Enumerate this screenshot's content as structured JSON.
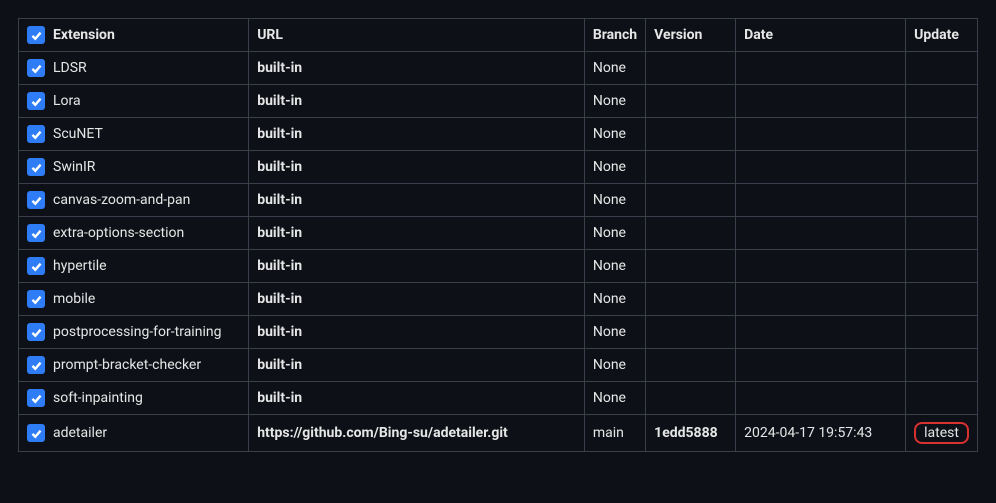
{
  "headers": {
    "extension": "Extension",
    "url": "URL",
    "branch": "Branch",
    "version": "Version",
    "date": "Date",
    "update": "Update"
  },
  "rows": [
    {
      "name": "LDSR",
      "url": "built-in",
      "url_bold": true,
      "branch": "None",
      "version": "",
      "date": "",
      "update": ""
    },
    {
      "name": "Lora",
      "url": "built-in",
      "url_bold": true,
      "branch": "None",
      "version": "",
      "date": "",
      "update": ""
    },
    {
      "name": "ScuNET",
      "url": "built-in",
      "url_bold": true,
      "branch": "None",
      "version": "",
      "date": "",
      "update": ""
    },
    {
      "name": "SwinIR",
      "url": "built-in",
      "url_bold": true,
      "branch": "None",
      "version": "",
      "date": "",
      "update": ""
    },
    {
      "name": "canvas-zoom-and-pan",
      "url": "built-in",
      "url_bold": true,
      "branch": "None",
      "version": "",
      "date": "",
      "update": ""
    },
    {
      "name": "extra-options-section",
      "url": "built-in",
      "url_bold": true,
      "branch": "None",
      "version": "",
      "date": "",
      "update": ""
    },
    {
      "name": "hypertile",
      "url": "built-in",
      "url_bold": true,
      "branch": "None",
      "version": "",
      "date": "",
      "update": ""
    },
    {
      "name": "mobile",
      "url": "built-in",
      "url_bold": true,
      "branch": "None",
      "version": "",
      "date": "",
      "update": ""
    },
    {
      "name": "postprocessing-for-training",
      "url": "built-in",
      "url_bold": true,
      "branch": "None",
      "version": "",
      "date": "",
      "update": ""
    },
    {
      "name": "prompt-bracket-checker",
      "url": "built-in",
      "url_bold": true,
      "branch": "None",
      "version": "",
      "date": "",
      "update": ""
    },
    {
      "name": "soft-inpainting",
      "url": "built-in",
      "url_bold": true,
      "branch": "None",
      "version": "",
      "date": "",
      "update": ""
    },
    {
      "name": "adetailer",
      "url": "https://github.com/Bing-su/adetailer.git",
      "url_bold": true,
      "branch": "main",
      "version": "1edd5888",
      "date": "2024-04-17 19:57:43",
      "update": "latest",
      "highlight_update": true
    }
  ]
}
